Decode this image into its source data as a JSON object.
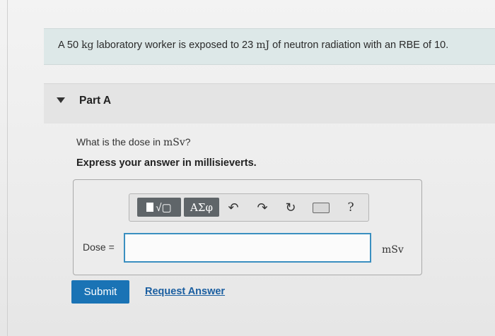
{
  "problem": {
    "text_before_mass": "A 50",
    "mass_unit": "kg",
    "text_middle": "laboratory worker is exposed to 23",
    "energy_unit": "mJ",
    "text_after": "of neutron radiation with an RBE of 10."
  },
  "part": {
    "title": "Part A"
  },
  "question": {
    "prompt": "What is the dose in",
    "unit": "mSv",
    "suffix": "?",
    "instruction": "Express your answer in millisieverts."
  },
  "toolbar": {
    "templates_glyph": "√▢",
    "greek_label": "ΑΣφ",
    "undo_glyph": "↶",
    "redo_glyph": "↷",
    "reset_glyph": "↻",
    "help_label": "?"
  },
  "answer": {
    "label": "Dose =",
    "value": "",
    "unit": "mSv"
  },
  "actions": {
    "submit_label": "Submit",
    "request_label": "Request Answer"
  },
  "colors": {
    "problem_bg": "#dde8e8",
    "accent_blue": "#1a73b5",
    "input_border": "#3a8fc0",
    "link": "#1a5ea0"
  }
}
